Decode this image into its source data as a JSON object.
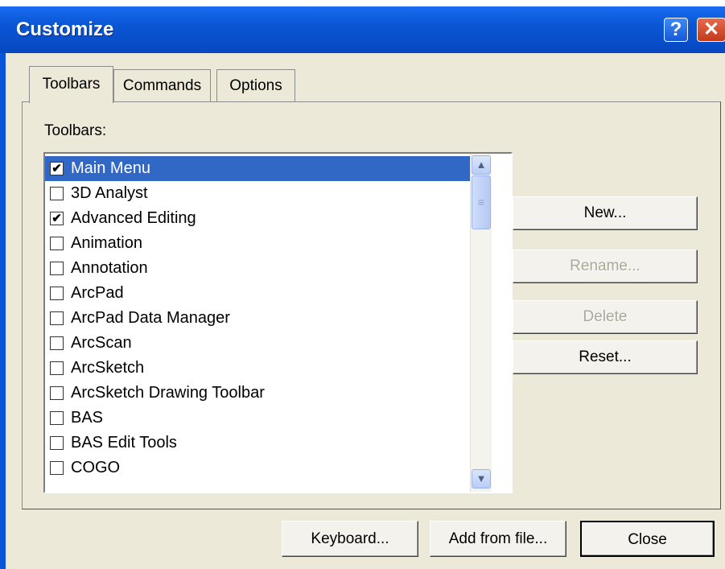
{
  "window": {
    "title": "Customize",
    "help_glyph": "?",
    "close_glyph": "✕"
  },
  "tabs": [
    {
      "label": "Toolbars",
      "active": true
    },
    {
      "label": "Commands",
      "active": false
    },
    {
      "label": "Options",
      "active": false
    }
  ],
  "toolbars_label": "Toolbars:",
  "toolbar_list": [
    {
      "label": "Main Menu",
      "checked": true,
      "selected": true
    },
    {
      "label": "3D Analyst",
      "checked": false,
      "selected": false
    },
    {
      "label": "Advanced Editing",
      "checked": true,
      "selected": false
    },
    {
      "label": "Animation",
      "checked": false,
      "selected": false
    },
    {
      "label": "Annotation",
      "checked": false,
      "selected": false
    },
    {
      "label": "ArcPad",
      "checked": false,
      "selected": false
    },
    {
      "label": "ArcPad Data Manager",
      "checked": false,
      "selected": false
    },
    {
      "label": "ArcScan",
      "checked": false,
      "selected": false
    },
    {
      "label": "ArcSketch",
      "checked": false,
      "selected": false
    },
    {
      "label": "ArcSketch Drawing Toolbar",
      "checked": false,
      "selected": false
    },
    {
      "label": "BAS",
      "checked": false,
      "selected": false
    },
    {
      "label": "BAS Edit Tools",
      "checked": false,
      "selected": false
    },
    {
      "label": "COGO",
      "checked": false,
      "selected": false
    }
  ],
  "side_buttons": {
    "new": {
      "label": "New...",
      "enabled": true
    },
    "rename": {
      "label": "Rename...",
      "enabled": false
    },
    "delete": {
      "label": "Delete",
      "enabled": false
    },
    "reset": {
      "label": "Reset...",
      "enabled": true
    }
  },
  "bottom_buttons": {
    "keyboard": "Keyboard...",
    "add_from_file": "Add from file...",
    "close": "Close"
  },
  "icons": {
    "scroll_up": "chevron-up-icon",
    "scroll_down": "chevron-down-icon",
    "check": "checkmark-icon"
  },
  "colors": {
    "titlebar": "#0a56d6",
    "selection": "#3168c6",
    "dialog_bg": "#ece9d8"
  }
}
